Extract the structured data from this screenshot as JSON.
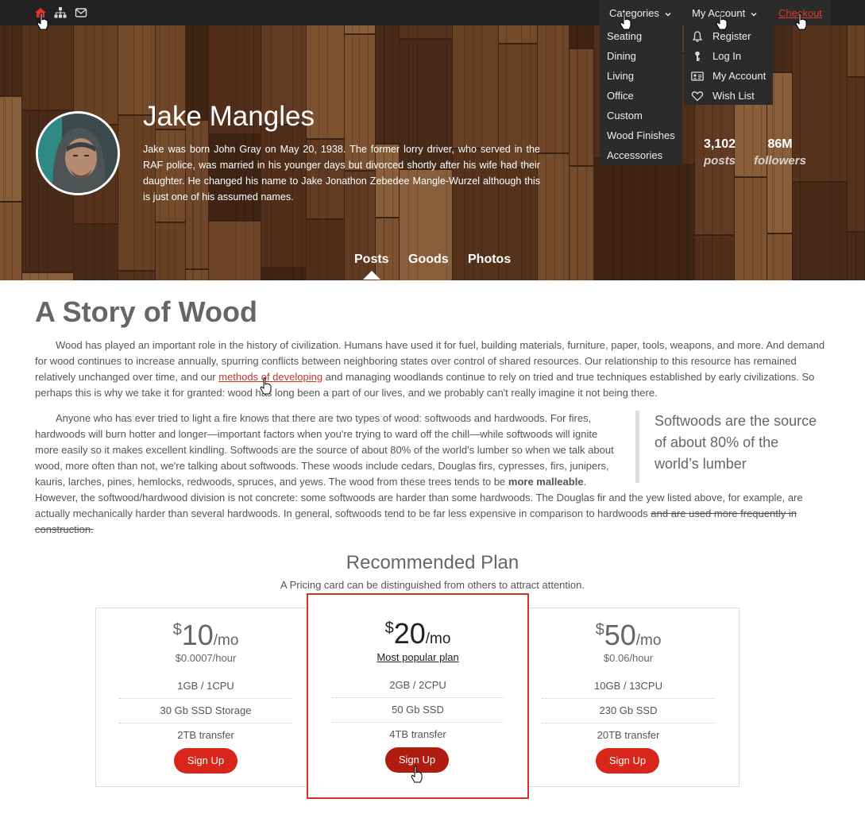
{
  "topbar": {
    "icons": [
      "home-icon",
      "sitemap-icon",
      "envelope-icon"
    ],
    "categories_label": "Categories",
    "my_account_label": "My Account",
    "checkout_label": "Checkout"
  },
  "categories_menu": [
    "Seating",
    "Dining",
    "Living",
    "Office",
    "Custom",
    "Wood Finishes",
    "Accessories"
  ],
  "account_menu": [
    {
      "icon": "bell-icon",
      "label": "Register"
    },
    {
      "icon": "key-icon",
      "label": "Log In"
    },
    {
      "icon": "id-card-icon",
      "label": "My Account"
    },
    {
      "icon": "heart-icon",
      "label": "Wish List"
    }
  ],
  "profile": {
    "name": "Jake Mangles",
    "bio": "Jake was born John Gray on May 20, 1938. The former lorry driver, who served in the RAF police, was married in his younger days but divorced shortly after his wife had their daughter. He changed his name to Jake Jonathon Zebedee Mangle-Wurzel although this is just one of his assumed names.",
    "stats": [
      {
        "value": "3,102",
        "label": "posts"
      },
      {
        "value": "86M",
        "label": "followers"
      }
    ],
    "tabs": [
      "Posts",
      "Goods",
      "Photos"
    ]
  },
  "article": {
    "title": "A Story of Wood",
    "p1_before": "Wood has played an important role in the history of civilization. Humans have used it for fuel, building materials, furniture, paper, tools, weapons, and more. And demand for wood continues to increase annually, spurring conflicts between neighboring states over control of shared resources. Our relationship to this resource has remained relatively unchanged over time, and our ",
    "p1_link": "methods of developing",
    "p1_after": " and managing woodlands continue to rely on tried and true techniques established by early civilizations. So perhaps this is why we take it for granted: wood has long been a part of our lives, and we probably can't really imagine it not being there.",
    "p2_before": "Anyone who has ever tried to light a fire knows that there are two types of wood: softwoods and hardwoods. For fires, hardwoods will burn hotter and longer—important factors when you're trying to ward off the chill—while softwoods will ignite more easily so it makes excellent kindling. Softwoods are the source of about 80% of the world's lumber so when we talk about wood, more often than not, we're talking about softwoods. These woods include cedars, Douglas firs, cypresses, firs, junipers, kauris, larches, pines, hemlocks, redwoods, spruces, and yews. The wood from these trees tends to be ",
    "p2_bold": "more malleable",
    "p2_after": ". However, the softwood/hardwood division is not concrete: some softwoods are harder than some hardwoods. The Douglas fir and the yew listed above, for example, are actually mechanically harder than several hardwoods. In general, softwoods tend to be far less expensive in comparison to hardwoods ",
    "p2_strike": "and are used more frequently in construction.",
    "pullquote": "Softwoods are the source of about 80% of the world’s lumber"
  },
  "pricing": {
    "title": "Recommended Plan",
    "subtitle": "A Pricing card can be distinguished from others to attract attention.",
    "plans": [
      {
        "currency": "$",
        "amount": "10",
        "period": "/mo",
        "sub": "$0.0007/hour",
        "features": [
          "1GB / 1CPU",
          "30 Gb SSD Storage",
          "2TB transfer"
        ],
        "button": "Sign Up"
      },
      {
        "currency": "$",
        "amount": "20",
        "period": "/mo",
        "sub": "Most popular plan",
        "features": [
          "2GB / 2CPU",
          "50 Gb SSD",
          "4TB transfer"
        ],
        "button": "Sign Up"
      },
      {
        "currency": "$",
        "amount": "50",
        "period": "/mo",
        "sub": "$0.06/hour",
        "features": [
          "10GB / 13CPU",
          "230 Gb SSD",
          "20TB transfer"
        ],
        "button": "Sign Up"
      }
    ]
  },
  "colors": {
    "accent_red": "#d8271a",
    "featured_border": "#d43322",
    "topbar": "#222222"
  }
}
